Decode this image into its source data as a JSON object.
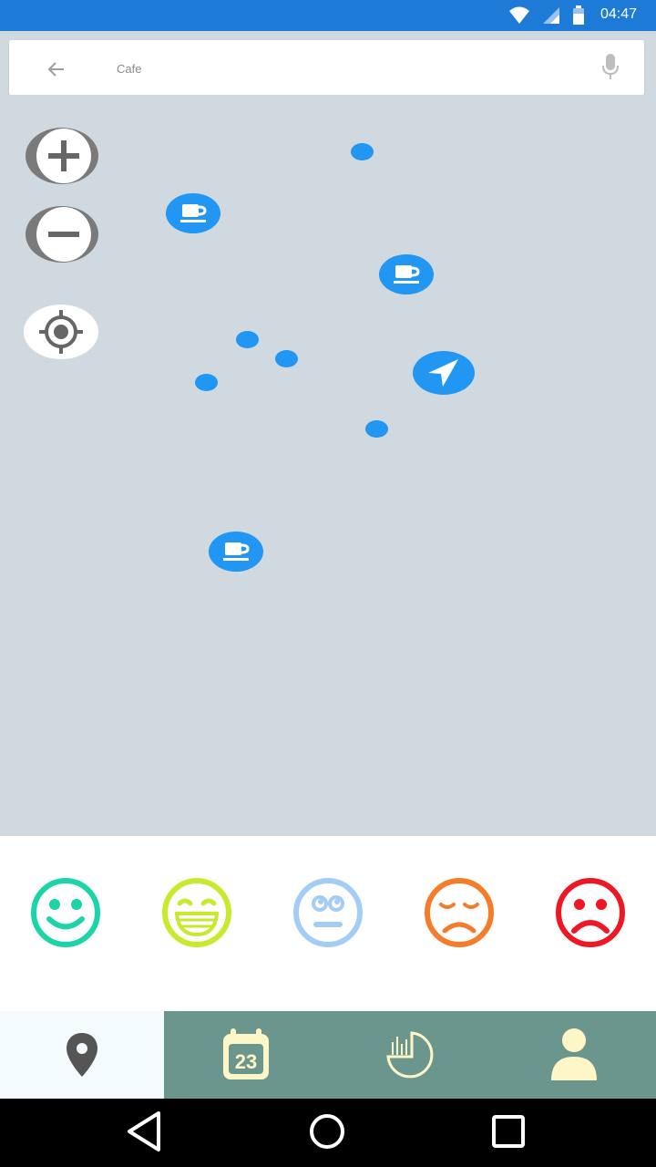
{
  "status": {
    "time": "04:47",
    "icons": [
      "wifi-icon",
      "signal-icon",
      "battery-icon"
    ]
  },
  "search": {
    "value": "Cafe",
    "back_icon": "back-arrow-icon",
    "mic_icon": "mic-icon"
  },
  "map": {
    "controls": [
      "zoom-in-button",
      "zoom-out-button",
      "my-location-button"
    ],
    "marker_color": "#2196f3",
    "cafe_icon": "coffee-cup-icon",
    "navigation_icon": "navigation-arrow-icon"
  },
  "moods": [
    {
      "name": "smile",
      "color": "#1cd4a8"
    },
    {
      "name": "grin",
      "color": "#c6ea2d"
    },
    {
      "name": "neutral",
      "color": "#a3cdf7"
    },
    {
      "name": "sad",
      "color": "#f57c2a"
    },
    {
      "name": "very-sad",
      "color": "#ee1723"
    }
  ],
  "tabs": [
    "map-pin-icon",
    "calendar-icon",
    "stats-icon",
    "profile-icon"
  ],
  "calendar_day": "23",
  "colors": {
    "statusbar": "#1d7ad6",
    "tabbar": "#6b968d",
    "tab_active": "#f4fbfd",
    "tab_icon": "#fff6c8",
    "map_bg": "#d0d9df"
  }
}
